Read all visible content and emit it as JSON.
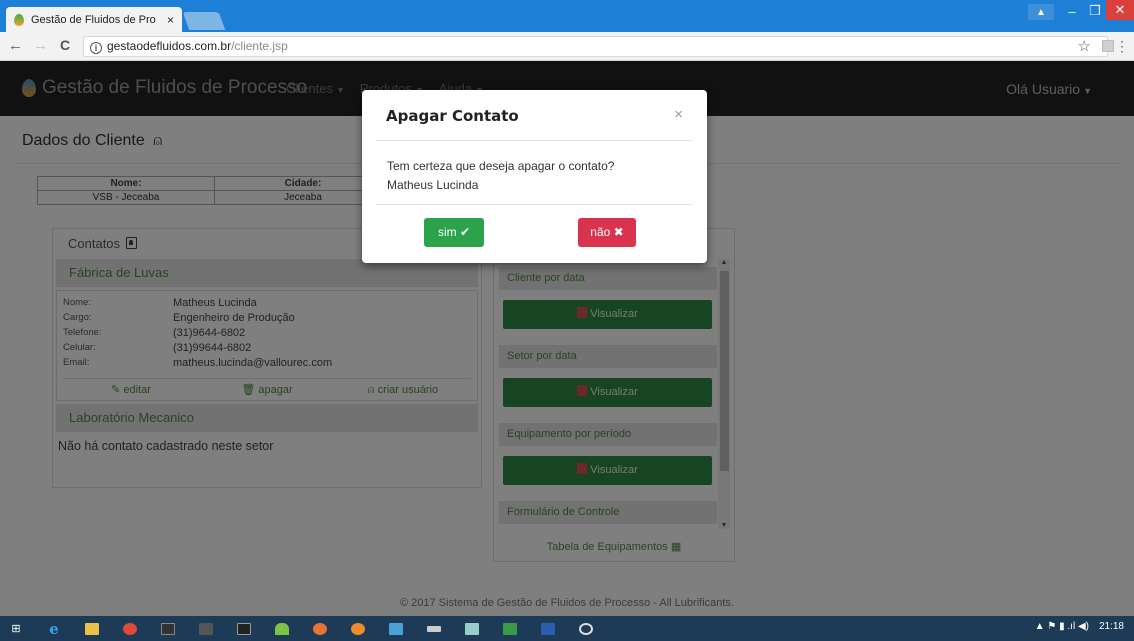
{
  "browser": {
    "tab_title": "Gestão de Fluidos de Pro",
    "tab_close": "×",
    "url_host": "gestaodefluidos.com.br",
    "url_path": "/cliente.jsp",
    "back_glyph": "←",
    "forward_glyph": "→",
    "reload_glyph": "C",
    "star_glyph": "☆",
    "menu_glyph": "⋮",
    "info_glyph": "i",
    "win_min": "–",
    "win_max": "❐",
    "win_close": "✕",
    "user_glyph": "▲"
  },
  "navbar": {
    "brand": "Gestão de Fluidos de Processo",
    "links": [
      "Clientes",
      "Produtos",
      "Ajuda"
    ],
    "user_menu": "Olá Usuario",
    "caret": "▼"
  },
  "page": {
    "title": "Dados do Cliente",
    "user_glyph": "⍝"
  },
  "client_table": {
    "headers": [
      "Nome:",
      "Cidade:",
      ""
    ],
    "row": [
      "VSB - Jeceaba",
      "Jeceaba",
      ""
    ]
  },
  "contacts": {
    "header": "Contatos",
    "sectors": [
      {
        "name": "Fábrica de Luvas",
        "contact": {
          "fields": [
            {
              "label": "Nome:",
              "value": "Matheus Lucinda"
            },
            {
              "label": "Cargo:",
              "value": "Engenheiro de Produção"
            },
            {
              "label": "Telefone:",
              "value": "(31)9644-6802"
            },
            {
              "label": "Celular:",
              "value": "(31)99644-6802"
            },
            {
              "label": "Email:",
              "value": "matheus.lucinda@vallourec.com"
            }
          ],
          "actions": [
            "editar",
            "apagar",
            "criar usuário"
          ],
          "action_icons": [
            "✎",
            "🗑",
            "⍝"
          ]
        }
      },
      {
        "name": "Laboratório Mecanico",
        "empty_message": "Não há contato cadastrado neste setor"
      }
    ]
  },
  "reports": {
    "items": [
      {
        "label": "Cliente por data",
        "button": "Visualizar"
      },
      {
        "label": "Setor por data",
        "button": "Visualizar"
      },
      {
        "label": "Equipamento por período",
        "button": "Visualizar"
      },
      {
        "label": "Formulário de Controle",
        "button": ""
      }
    ],
    "footer_link": "Tabela de Equipamentos ▦",
    "scroll_up": "▲",
    "scroll_down": "▼"
  },
  "footer": "© 2017 Sistema de Gestão de Fluidos de Processo - All Lubrificants.",
  "modal": {
    "title": "Apagar Contato",
    "close": "×",
    "message_line1": "Tem certeza que deseja apagar o contato?",
    "message_line2": "Matheus Lucinda",
    "yes": "sim ✔",
    "no": "não ✖"
  },
  "taskbar": {
    "start": "⊞",
    "ie": "e",
    "clock": "21:18",
    "tray_icons": "▲  ⚑  ▮ .ıl ◀)"
  },
  "colors": {
    "accent_green": "#2e8b43",
    "danger_red": "#d9334d",
    "navbar_bg": "#222222",
    "titlebar_blue": "#1d7fd6"
  }
}
